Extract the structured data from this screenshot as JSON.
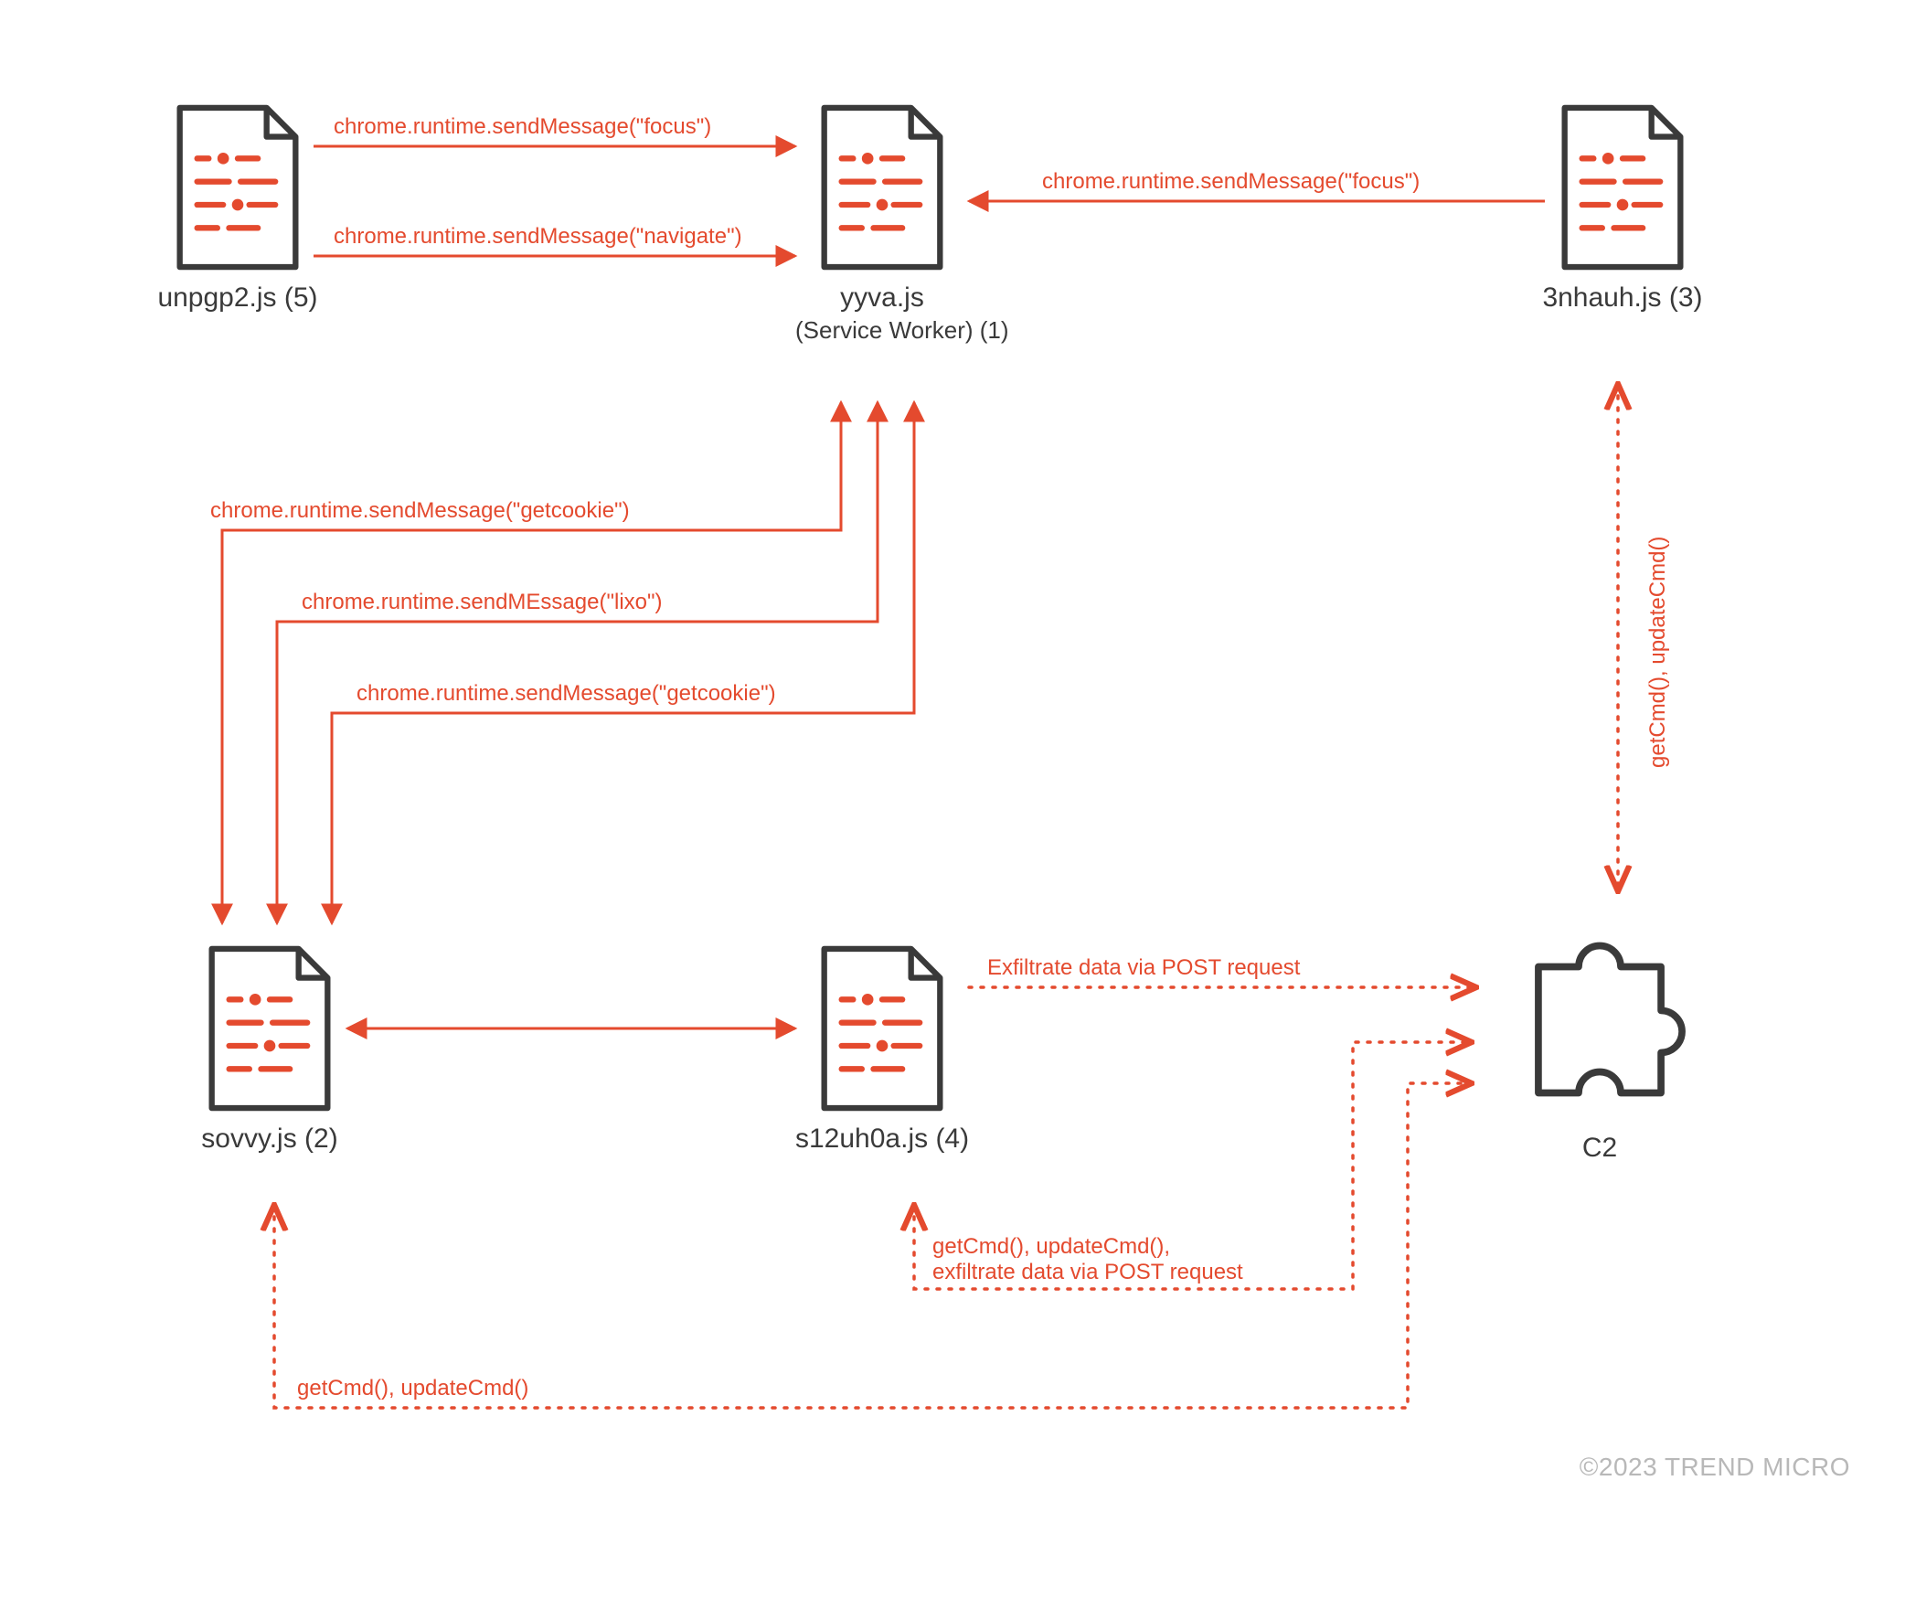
{
  "colors": {
    "accent": "#e44a2e",
    "line_dark": "#3a3a3a",
    "text": "#3a3a3a",
    "muted": "#b8b8b8"
  },
  "nodes": {
    "unpgp2": {
      "label": "unpgp2.js (5)"
    },
    "yyva": {
      "label": "yyva.js",
      "sublabel": "(Service Worker) (1)"
    },
    "3nhauh": {
      "label": "3nhauh.js (3)"
    },
    "sovvy": {
      "label": "sovvy.js (2)"
    },
    "s12uh0a": {
      "label": "s12uh0a.js (4)"
    },
    "c2": {
      "label": "C2"
    }
  },
  "edges": {
    "unpgp2_yyva_focus": "chrome.runtime.sendMessage(\"focus\")",
    "unpgp2_yyva_navigate": "chrome.runtime.sendMessage(\"navigate\")",
    "3nhauh_yyva_focus": "chrome.runtime.sendMessage(\"focus\")",
    "sovvy_yyva_getcookie1": "chrome.runtime.sendMessage(\"getcookie\")",
    "sovvy_yyva_lixo": "chrome.runtime.sendMEssage(\"lixo\")",
    "sovvy_yyva_getcookie2": "chrome.runtime.sendMessage(\"getcookie\")",
    "s12uh0a_c2_exfil": "Exfiltrate data via POST request",
    "s12uh0a_c2_cmds": "getCmd(), updateCmd(),\nexfiltrate data via POST request",
    "sovvy_c2_cmds": "getCmd(), updateCmd()",
    "3nhauh_c2_cmds": "getCmd(), updateCmd()"
  },
  "copyright": "©2023 TREND MICRO"
}
